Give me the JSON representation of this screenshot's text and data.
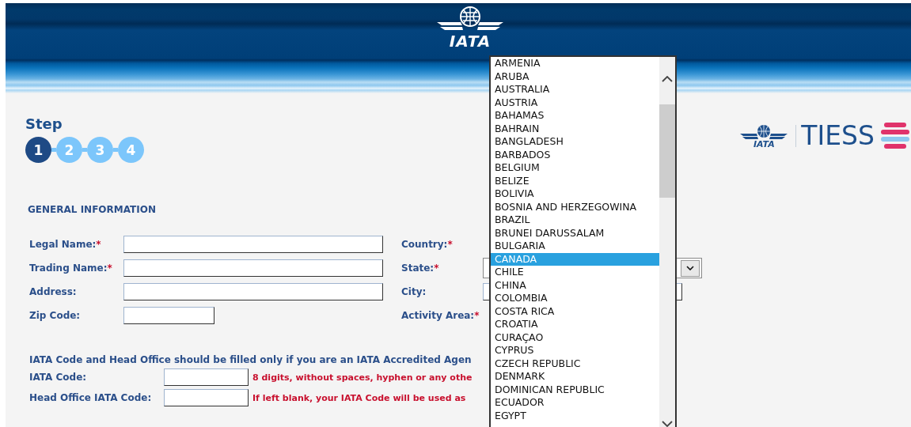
{
  "header": {
    "logo_text": "IATA"
  },
  "brand": {
    "logo_text": "IATA",
    "product": "TIESS"
  },
  "steps": {
    "title": "Step",
    "items": [
      {
        "label": "1",
        "selected": true
      },
      {
        "label": "2",
        "selected": false
      },
      {
        "label": "3",
        "selected": false
      },
      {
        "label": "4",
        "selected": false
      }
    ]
  },
  "section_title": "GENERAL INFORMATION",
  "required_mark": "*",
  "rows": [
    {
      "left": {
        "label": "Legal Name:",
        "required": true,
        "kind": "wide"
      },
      "right": {
        "label": "Country:",
        "required": true,
        "kind": "covered"
      }
    },
    {
      "left": {
        "label": "Trading Name:",
        "required": true,
        "kind": "wide"
      },
      "right": {
        "label": "State:",
        "required": true,
        "kind": "select"
      }
    },
    {
      "left": {
        "label": "Address:",
        "required": false,
        "kind": "wide"
      },
      "right": {
        "label": "City:",
        "required": false,
        "kind": "text"
      }
    },
    {
      "left": {
        "label": "Zip Code:",
        "required": false,
        "kind": "short"
      },
      "right": {
        "label": "Activity Area:",
        "required": true,
        "kind": "covered"
      }
    }
  ],
  "note": "IATA Code and Head Office should be filled only if you are an IATA Accredited Agen",
  "iata_fields": [
    {
      "label": "IATA Code:",
      "hint": "8 digits, without spaces, hyphen or any othe"
    },
    {
      "label": "Head Office IATA Code:",
      "hint": "If left blank, your IATA Code will be used as"
    }
  ],
  "country_list": {
    "items": [
      {
        "label": "ARMENIA",
        "selected": false
      },
      {
        "label": "ARUBA",
        "selected": false
      },
      {
        "label": "AUSTRALIA",
        "selected": false
      },
      {
        "label": "AUSTRIA",
        "selected": false
      },
      {
        "label": "BAHAMAS",
        "selected": false
      },
      {
        "label": "BAHRAIN",
        "selected": false
      },
      {
        "label": "BANGLADESH",
        "selected": false
      },
      {
        "label": "BARBADOS",
        "selected": false
      },
      {
        "label": "BELGIUM",
        "selected": false
      },
      {
        "label": "BELIZE",
        "selected": false
      },
      {
        "label": "BOLIVIA",
        "selected": false
      },
      {
        "label": "BOSNIA AND HERZEGOWINA",
        "selected": false
      },
      {
        "label": "BRAZIL",
        "selected": false
      },
      {
        "label": "BRUNEI DARUSSALAM",
        "selected": false
      },
      {
        "label": "BULGARIA",
        "selected": false
      },
      {
        "label": "CANADA",
        "selected": true
      },
      {
        "label": "CHILE",
        "selected": false
      },
      {
        "label": "CHINA",
        "selected": false
      },
      {
        "label": "COLOMBIA",
        "selected": false
      },
      {
        "label": "COSTA RICA",
        "selected": false
      },
      {
        "label": "CROATIA",
        "selected": false
      },
      {
        "label": "CURAÇAO",
        "selected": false
      },
      {
        "label": "CYPRUS",
        "selected": false
      },
      {
        "label": "CZECH REPUBLIC",
        "selected": false
      },
      {
        "label": "DENMARK",
        "selected": false
      },
      {
        "label": "DOMINICAN REPUBLIC",
        "selected": false
      },
      {
        "label": "ECUADOR",
        "selected": false
      },
      {
        "label": "EGYPT",
        "selected": false
      }
    ]
  }
}
